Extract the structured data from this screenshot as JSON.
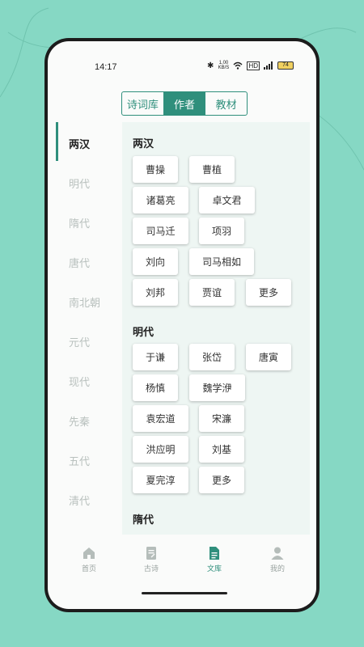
{
  "status_bar": {
    "time": "14:17",
    "net_speed_top": "1.00",
    "net_speed_bottom": "KB/S",
    "battery": "74"
  },
  "top_tabs": [
    {
      "label": "诗词库",
      "active": false
    },
    {
      "label": "作者",
      "active": true
    },
    {
      "label": "教材",
      "active": false
    }
  ],
  "sidebar": [
    {
      "label": "两汉",
      "active": true
    },
    {
      "label": "明代",
      "active": false
    },
    {
      "label": "隋代",
      "active": false
    },
    {
      "label": "唐代",
      "active": false
    },
    {
      "label": "南北朝",
      "active": false
    },
    {
      "label": "元代",
      "active": false
    },
    {
      "label": "现代",
      "active": false
    },
    {
      "label": "先秦",
      "active": false
    },
    {
      "label": "五代",
      "active": false
    },
    {
      "label": "清代",
      "active": false
    }
  ],
  "sections": [
    {
      "title": "两汉",
      "authors": [
        "曹操",
        "曹植",
        "诸葛亮",
        "卓文君",
        "司马迁",
        "项羽",
        "刘向",
        "司马相如",
        "刘邦",
        "贾谊",
        "更多"
      ]
    },
    {
      "title": "明代",
      "authors": [
        "于谦",
        "张岱",
        "唐寅",
        "杨慎",
        "魏学洢",
        "袁宏道",
        "宋濂",
        "洪应明",
        "刘基",
        "夏完淳",
        "更多"
      ]
    },
    {
      "title": "隋代",
      "authors": []
    }
  ],
  "bottom_nav": [
    {
      "label": "首页",
      "icon": "home-icon",
      "active": false
    },
    {
      "label": "古诗",
      "icon": "poem-icon",
      "active": false
    },
    {
      "label": "文库",
      "icon": "library-icon",
      "active": true
    },
    {
      "label": "我的",
      "icon": "profile-icon",
      "active": false
    }
  ],
  "colors": {
    "accent": "#2f8f7c",
    "background": "#86d8c4",
    "inactive": "#b9c1be"
  }
}
